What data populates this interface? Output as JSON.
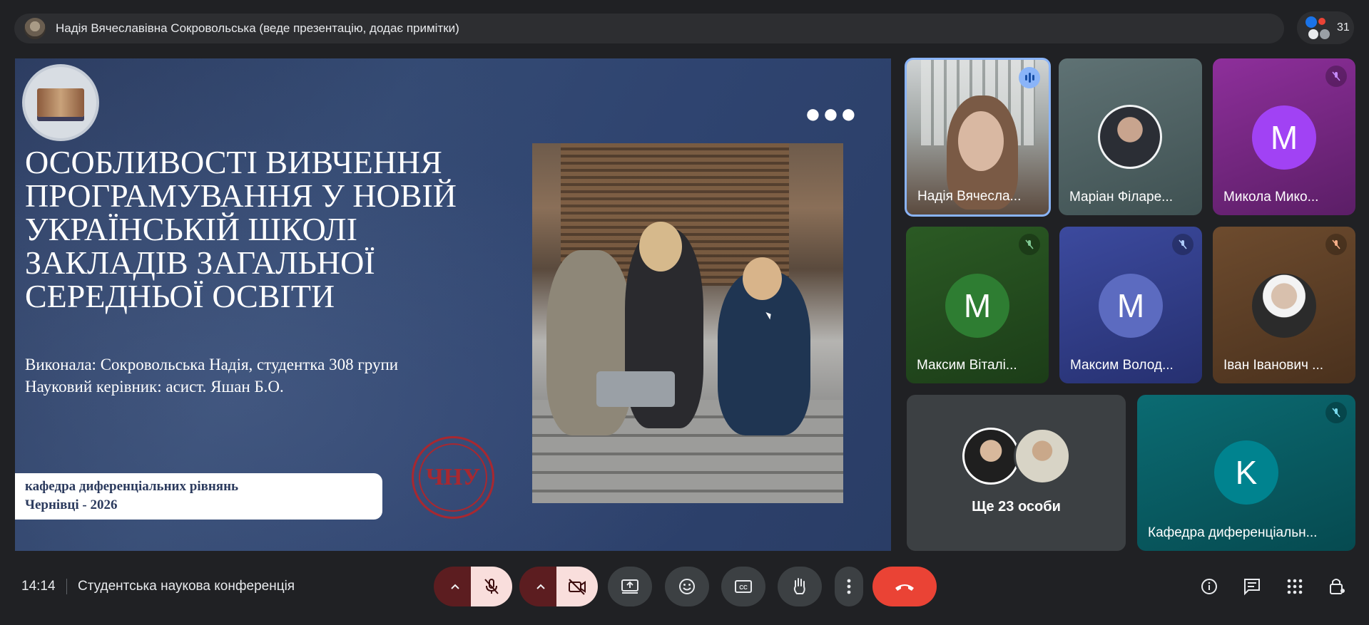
{
  "presenter_bar": {
    "text": "Надія Вячеславівна Сокровольська (веде презентацію, додає примітки)"
  },
  "participants_count": "31",
  "slide": {
    "title": "ОСОБЛИВОСТІ ВИВЧЕННЯ ПРОГРАМУВАННЯ У НОВІЙ УКРАЇНСЬКІЙ ШКОЛІ ЗАКЛАДІВ ЗАГАЛЬНОЇ СЕРЕДНЬОЇ ОСВІТИ",
    "author_line": "Виконала: Сокровольська Надія, студентка 308 групи",
    "supervisor_line": "Науковий керівник: асист. Яшан Б.О.",
    "dept_line1": "кафедра диференціальних рівнянь",
    "dept_line2": "Чернівці - 2026",
    "dots": "●●●"
  },
  "tiles": {
    "t1": {
      "name": "Надія Вячесла...",
      "speaking": true
    },
    "t2": {
      "name": "Маріан Філаре..."
    },
    "t3": {
      "name": "Микола Мико...",
      "initial": "M",
      "color": "#a142f4"
    },
    "t4": {
      "name": "Максим Віталі...",
      "initial": "M",
      "color": "#2e7d32"
    },
    "t5": {
      "name": "Максим Волод...",
      "initial": "M",
      "color": "#5c6bc0"
    },
    "t6": {
      "name": "Іван Іванович ..."
    },
    "t7": {
      "name": "Ще 23 особи"
    },
    "t8": {
      "name": "Кафедра диференціальн...",
      "initial": "K",
      "color": "#00838f"
    }
  },
  "bottom": {
    "time": "14:14",
    "meeting_title": "Студентська наукова конференція"
  },
  "colors": {
    "end_call": "#ea4335",
    "mic_off_bg": "#f9dedc",
    "mic_toggle_bg": "#5c1d20",
    "speaking_ring": "#8ab4f8"
  }
}
